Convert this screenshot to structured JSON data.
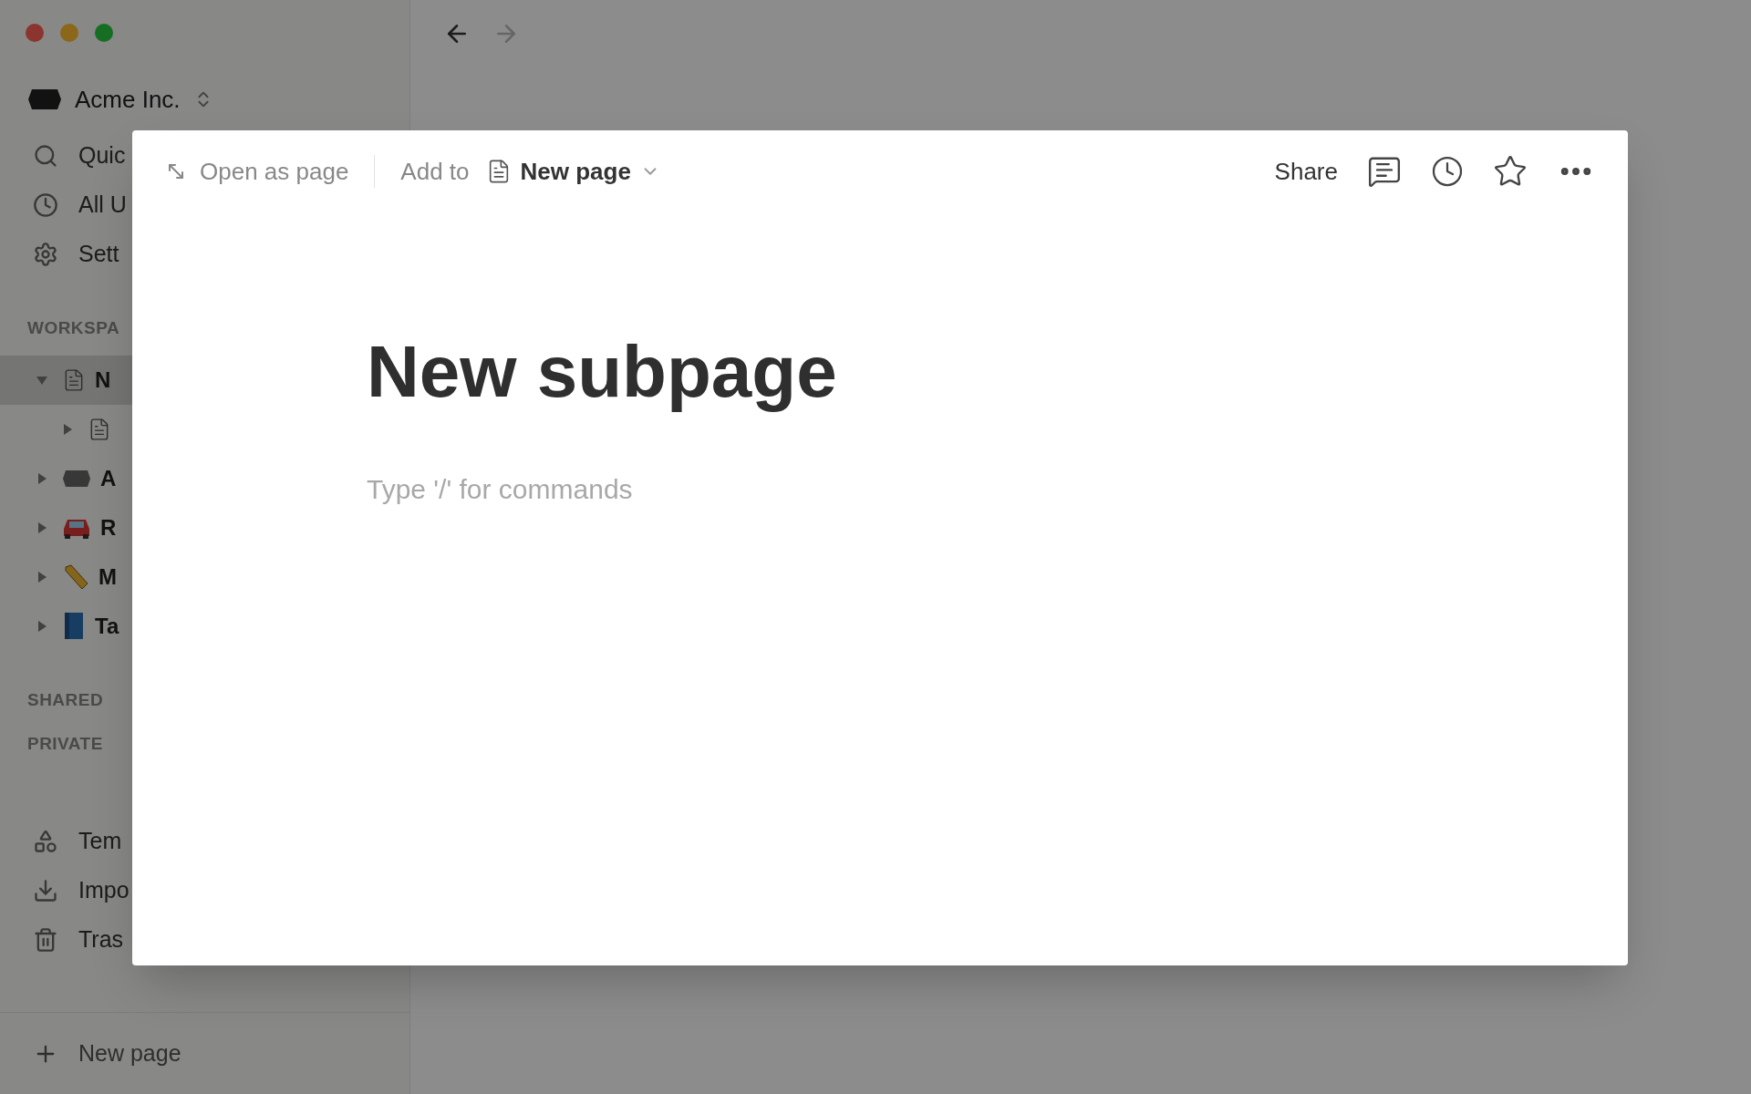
{
  "navigation": {
    "back": {
      "disabled": false
    },
    "forward": {
      "disabled": true
    }
  },
  "sidebar": {
    "workspace": "Acme Inc.",
    "top_items": [
      {
        "kind": "search",
        "label": "Quic"
      },
      {
        "kind": "updates",
        "label": "All U"
      },
      {
        "kind": "settings",
        "label": "Sett"
      }
    ],
    "section": "WORKSPA",
    "tree": [
      {
        "kind": "page",
        "label": "N",
        "selected": true,
        "expanded": true,
        "children": [
          {
            "kind": "page",
            "selected": false,
            "expanded": false
          }
        ]
      },
      {
        "kind": "acme",
        "label": "A",
        "selected": false,
        "expanded": false
      },
      {
        "kind": "car",
        "label": "R",
        "selected": false,
        "expanded": false
      },
      {
        "kind": "pencil",
        "label": "M",
        "selected": false,
        "expanded": false
      },
      {
        "kind": "book",
        "label": "Ta",
        "selected": false,
        "expanded": false
      }
    ],
    "more_sections": [
      "SHARED",
      "PRIVATE"
    ],
    "bottom_items": [
      {
        "kind": "templates",
        "label": "Tem"
      },
      {
        "kind": "import",
        "label": "Impo"
      },
      {
        "kind": "trash",
        "label": "Tras"
      }
    ],
    "new_page": "New page"
  },
  "modal": {
    "open_as_page": "Open as page",
    "add_to": "Add to",
    "breadcrumb": "New page",
    "share": "Share",
    "title": "New subpage",
    "placeholder": "Type '/' for commands"
  }
}
